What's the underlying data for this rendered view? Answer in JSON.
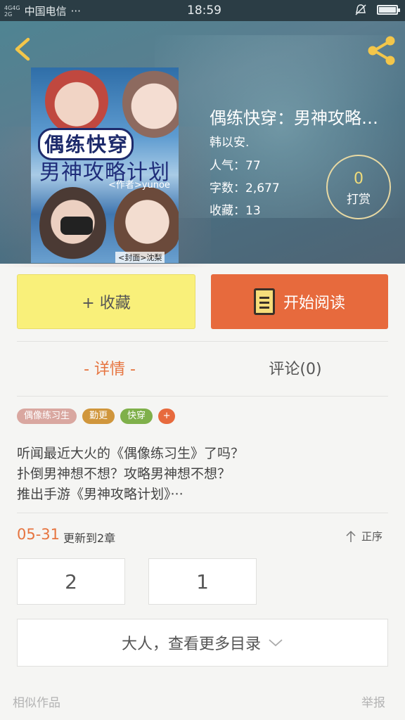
{
  "status_bar": {
    "carrier": "中国电信",
    "signal_labels": [
      "4G",
      "4G",
      "2G"
    ],
    "more": "···",
    "time": "18:59"
  },
  "book": {
    "title": "偶练快穿：男神攻略…",
    "author": "韩以安.",
    "popularity": "人气：77",
    "word_count": "字数：2,677",
    "favorites": "收藏：13",
    "cover": {
      "title_line1": "偶练快穿",
      "title_line2": "男神攻略计划",
      "author_tag": "<作者>yunoe",
      "cover_credit": "<封面>沈梨"
    }
  },
  "tip": {
    "count": "0",
    "label": "打赏"
  },
  "buttons": {
    "favorite": "+ 收藏",
    "read": "开始阅读"
  },
  "tabs": {
    "detail": "- 详情 -",
    "comments": "评论(0)"
  },
  "tags": [
    "偶像练习生",
    "勤更",
    "快穿",
    "+"
  ],
  "description": [
    "听闻最近大火的《偶像练习生》了吗？",
    "扑倒男神想不想？攻略男神想不想？",
    "推出手游《男神攻略计划》···"
  ],
  "update": {
    "date": "05-31",
    "text": "更新到2章",
    "sort_label": "正序"
  },
  "chapters": [
    "2",
    "1"
  ],
  "more_catalog": "大人，查看更多目录",
  "footer": {
    "similar": "相似作品",
    "report": "举报"
  },
  "colors": {
    "accent": "#e76a3d",
    "favorite_bg": "#f9f07a",
    "tip_number": "#f0dc7a"
  }
}
